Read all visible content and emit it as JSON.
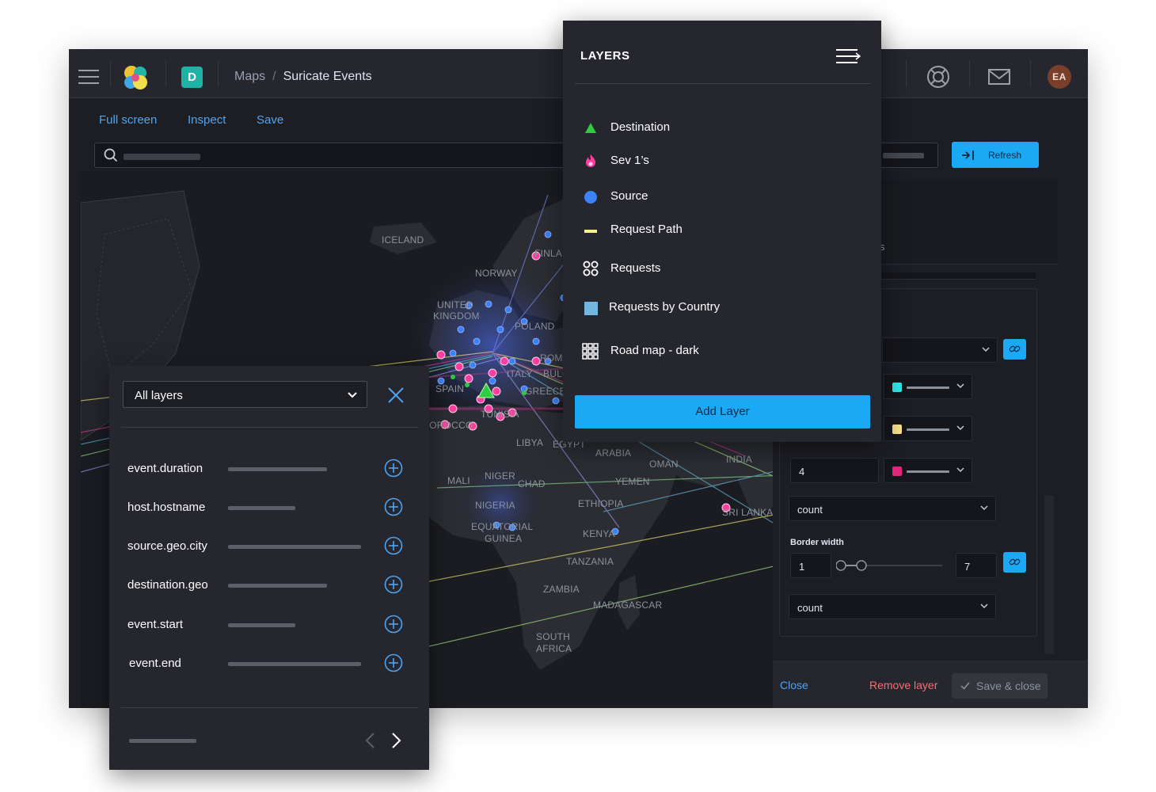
{
  "header": {
    "space_initial": "D",
    "breadcrumb": [
      "Maps",
      "Suricate Events"
    ],
    "breadcrumb_separator": "/",
    "user_initials": "EA",
    "icons": [
      "menu-icon",
      "elastic-logo",
      "help-icon",
      "mail-icon"
    ]
  },
  "toolbar": {
    "links": [
      "Full screen",
      "Inspect",
      "Save"
    ],
    "refresh_label": "Refresh"
  },
  "map": {
    "labels": [
      "ICELAND",
      "FINLA",
      "NORWAY",
      "UNITED",
      "KINGDOM",
      "POLAND",
      "ROMA",
      "ITALY",
      "BULGA",
      "GREECE",
      "SPAIN",
      "TUNISIA",
      "MOROCCO",
      "LIBYA",
      "EGYPT",
      "ARABIA",
      "OMAN",
      "INDIA",
      "YEMEN",
      "MALI",
      "NIGER",
      "CHAD",
      "NIGERIA",
      "ETHIOPIA",
      "SRI LANKA",
      "EQUATORIAL",
      "GUINEA",
      "KENYA",
      "TANZANIA",
      "ZAMBIA",
      "MADAGASCAR",
      "SOUTH",
      "AFRICA"
    ],
    "colors": {
      "ocean": "#1b1c21",
      "land": "#2b2d33",
      "destination": "#2ecc40",
      "sev1": "#ff3fa0",
      "source": "#3b82f6"
    }
  },
  "layers_panel": {
    "title": "LAYERS",
    "items": [
      {
        "label": "Destination",
        "icon": "triangle-icon",
        "color": "#2ecc40"
      },
      {
        "label": "Sev 1’s",
        "icon": "flame-icon",
        "color": "#ff3fa0"
      },
      {
        "label": "Source",
        "icon": "circle-icon",
        "color": "#3b82f6"
      },
      {
        "label": "Request Path",
        "icon": "line-icon",
        "color": "#f7f08c"
      },
      {
        "label": "Requests",
        "icon": "cluster-icon",
        "color": "#ffffff"
      },
      {
        "label": "Requests by Country",
        "icon": "square-icon",
        "color": "#72b7e0"
      },
      {
        "label": "Road map - dark",
        "icon": "grid-icon",
        "color": "#ffffff"
      }
    ],
    "add_label": "Add Layer"
  },
  "attributes_panel": {
    "filter_value": "All layers",
    "fields": [
      {
        "name": "event.duration"
      },
      {
        "name": "host.hostname"
      },
      {
        "name": "source.geo.city"
      },
      {
        "name": "destination.geo"
      },
      {
        "name": "event.start"
      },
      {
        "name": "event.end"
      }
    ]
  },
  "editor": {
    "partial_text": "s",
    "value_4": "4",
    "select_count_1": "count",
    "border_width_label": "Border width",
    "border_min": "1",
    "border_max": "7",
    "select_count_2": "count",
    "swatch_colors": [
      "#2ee6e6",
      "#f7e08c",
      "#e0267a"
    ],
    "close_label": "Close",
    "remove_label": "Remove layer",
    "save_label": "Save & close"
  }
}
